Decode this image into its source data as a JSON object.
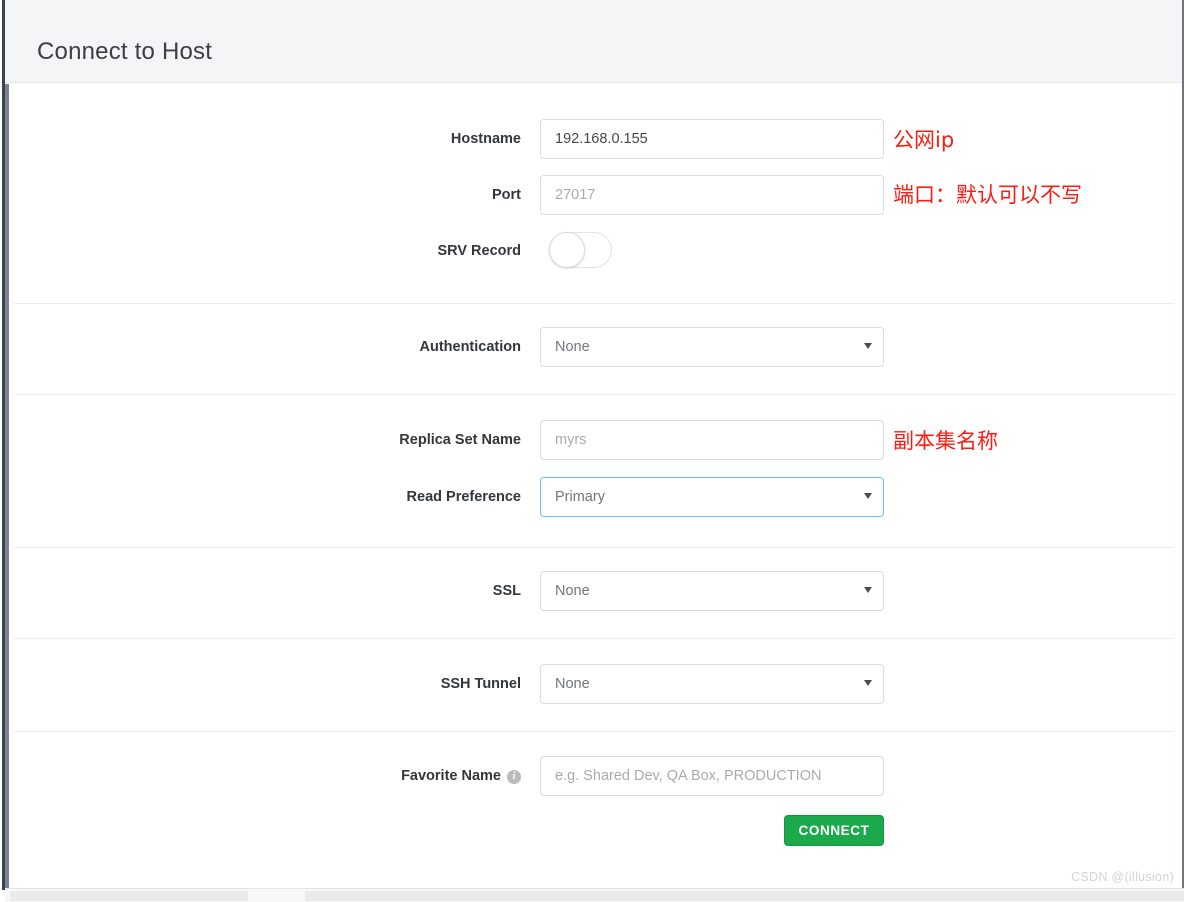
{
  "window": {
    "title": "Connect to Host"
  },
  "form": {
    "fields": [
      {
        "key": "hostname",
        "label": "Hostname",
        "type": "text",
        "value": "192.168.0.155",
        "placeholder": "",
        "annotation": "公网ip"
      },
      {
        "key": "port",
        "label": "Port",
        "type": "text",
        "value": "",
        "placeholder": "27017",
        "annotation": "端口：默认可以不写"
      },
      {
        "key": "srv_record",
        "label": "SRV Record",
        "type": "toggle",
        "state": "off"
      },
      {
        "key": "authentication",
        "label": "Authentication",
        "type": "select",
        "value": "None"
      },
      {
        "key": "replica_set_name",
        "label": "Replica Set Name",
        "type": "text",
        "value": "",
        "placeholder": "myrs",
        "annotation": "副本集名称"
      },
      {
        "key": "read_preference",
        "label": "Read Preference",
        "type": "select",
        "value": "Primary",
        "focused": true
      },
      {
        "key": "ssl",
        "label": "SSL",
        "type": "select",
        "value": "None"
      },
      {
        "key": "ssh_tunnel",
        "label": "SSH Tunnel",
        "type": "select",
        "value": "None"
      },
      {
        "key": "favorite_name",
        "label": "Favorite Name",
        "type": "text",
        "value": "",
        "placeholder": "e.g. Shared Dev, QA Box, PRODUCTION",
        "info_glyph": "i"
      }
    ],
    "connect_button_label": "CONNECT"
  },
  "colors": {
    "accent_green": "#1ba94c",
    "annotation_red": "#fd1b12",
    "focus_blue": "#6ec1ee",
    "header_bg": "#f4f5f7"
  },
  "watermark": "CSDN @(illusion)"
}
